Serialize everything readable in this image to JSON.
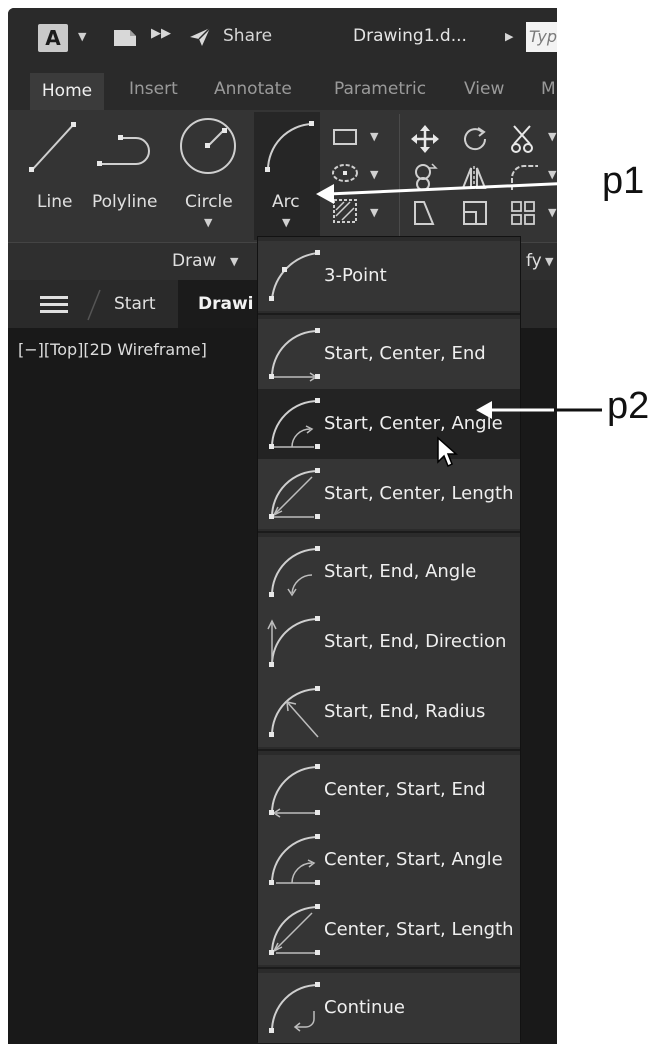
{
  "titlebar": {
    "app_logo": "A",
    "share_label": "Share",
    "document_title": "Drawing1.d...",
    "search_placeholder": "Typ"
  },
  "ribbon_tabs": [
    {
      "label": "Home",
      "active": true
    },
    {
      "label": "Insert"
    },
    {
      "label": "Annotate"
    },
    {
      "label": "Parametric"
    },
    {
      "label": "View"
    },
    {
      "label": "M"
    }
  ],
  "draw_panel": {
    "tools": [
      {
        "label": "Line"
      },
      {
        "label": "Polyline"
      },
      {
        "label": "Circle"
      },
      {
        "label": "Arc"
      }
    ],
    "footer_label": "Draw",
    "modify_footer_fragment": "fy"
  },
  "file_tabs": {
    "start_label": "Start",
    "drawing_label": "Drawi"
  },
  "viewport": {
    "label": "[−][Top][2D Wireframe]"
  },
  "arc_menu": {
    "items": [
      {
        "label": "3-Point",
        "icon": "arc-3point-icon"
      },
      {
        "label": "Start, Center, End",
        "icon": "arc-start-center-end-icon"
      },
      {
        "label": "Start, Center, Angle",
        "icon": "arc-start-center-angle-icon",
        "hovered": true
      },
      {
        "label": "Start, Center, Length",
        "icon": "arc-start-center-length-icon"
      },
      {
        "label": "Start, End, Angle",
        "icon": "arc-start-end-angle-icon"
      },
      {
        "label": "Start, End, Direction",
        "icon": "arc-start-end-direction-icon"
      },
      {
        "label": "Start, End, Radius",
        "icon": "arc-start-end-radius-icon"
      },
      {
        "label": "Center, Start, End",
        "icon": "arc-center-start-end-icon"
      },
      {
        "label": "Center, Start, Angle",
        "icon": "arc-center-start-angle-icon"
      },
      {
        "label": "Center, Start, Length",
        "icon": "arc-center-start-length-icon"
      },
      {
        "label": "Continue",
        "icon": "arc-continue-icon"
      }
    ]
  },
  "annotations": {
    "p1": "p1",
    "p2": "p2"
  }
}
